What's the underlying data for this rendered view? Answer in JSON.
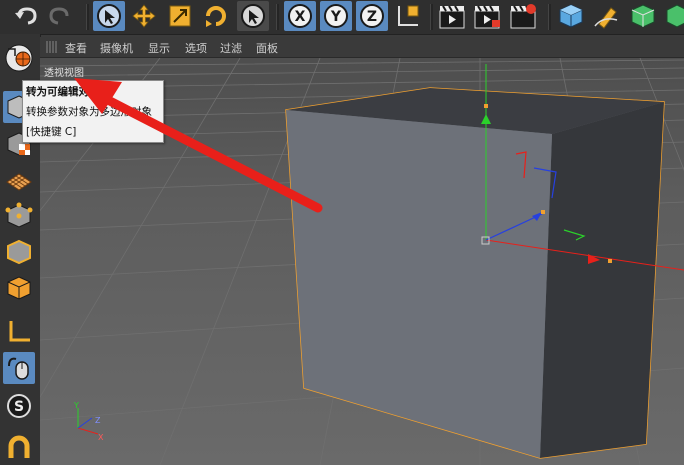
{
  "menu": {
    "items": [
      "查看",
      "摄像机",
      "显示",
      "选项",
      "过滤",
      "面板"
    ]
  },
  "viewport": {
    "label": "透视视图"
  },
  "tooltip": {
    "title": "转为可编辑对象",
    "description": "转换参数对象为多边形对象",
    "shortcut": "[快捷键 C]"
  },
  "axis_gizmo": {
    "x": "X",
    "y": "Y",
    "z": "Z"
  },
  "toolbar": {
    "axis_x": "X",
    "axis_y": "Y",
    "axis_z": "Z"
  },
  "sidebar": {
    "spline_icon_letter": "S"
  },
  "colors": {
    "accent_blue": "#4a90d9",
    "selection_orange": "#f0a030",
    "arrow_red": "#e8201a",
    "axis_green": "#2bd02b",
    "axis_blue": "#2640e0"
  }
}
